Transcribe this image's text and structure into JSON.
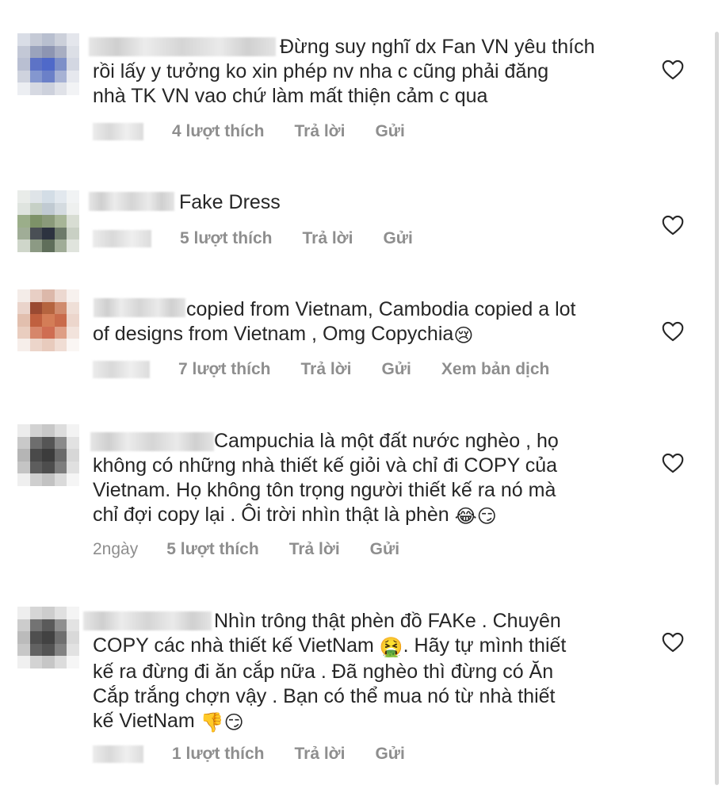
{
  "comments": [
    {
      "text": "Đừng suy nghĩ dx Fan VN yêu thích rồi lấy y tưởng ko xin phép nv nha c cũng phải đăng nhà TK VN vao chứ làm mất thiện cảm c qua",
      "line1": "Đừng suy nghĩ dx Fan VN yêu thích",
      "line2": "rồi lấy y tưởng ko xin phép nv nha c cũng phải đăng",
      "line3": "nhà TK VN vao chứ làm mất thiện cảm c qua",
      "likes": "4 lượt thích",
      "reply": "Trả lời",
      "send": "Gửi"
    },
    {
      "line1": "Fake Dress",
      "likes": "5 lượt thích",
      "reply": "Trả lời",
      "send": "Gửi"
    },
    {
      "line1": "copied from Vietnam, Cambodia copied a lot",
      "line2": "of designs from Vietnam , Omg Copychia",
      "emoji1": "😢",
      "likes": "7 lượt thích",
      "reply": "Trả lời",
      "send": "Gửi",
      "translate": "Xem bản dịch"
    },
    {
      "line1": "Campuchia là một đất nước nghèo , họ",
      "line2": "không có những nhà thiết kế giỏi và chỉ đi COPY của",
      "line3": "Vietnam. Họ không tôn trọng người thiết kế ra nó mà",
      "line4": "chỉ đợi copy lại . Ôi trời nhìn thật là phèn",
      "emoji1": "😂",
      "emoji2": "😏",
      "time": "2ngày",
      "likes": "5 lượt thích",
      "reply": "Trả lời",
      "send": "Gửi"
    },
    {
      "line1": "Nhìn trông thật phèn đồ FAKe . Chuyên",
      "line2": "COPY các nhà thiết kế VietNam",
      "emoji1": "🤮",
      "line2b": ". Hãy tự mình thiết",
      "line3": "kế ra đừng đi ăn cắp nữa . Đã nghèo thì đừng có Ăn",
      "line4": "Cắp trắng chợn vậy . Bạn có thể mua nó từ nhà thiết",
      "line5": "kế VietNam",
      "emoji2": "👎",
      "emoji3": "😏",
      "likes": "1 lượt thích",
      "reply": "Trả lời",
      "send": "Gửi"
    }
  ],
  "icons": {
    "like": "heart-outline-icon"
  },
  "colors": {
    "text": "#262626",
    "meta": "#8e8e8e"
  }
}
